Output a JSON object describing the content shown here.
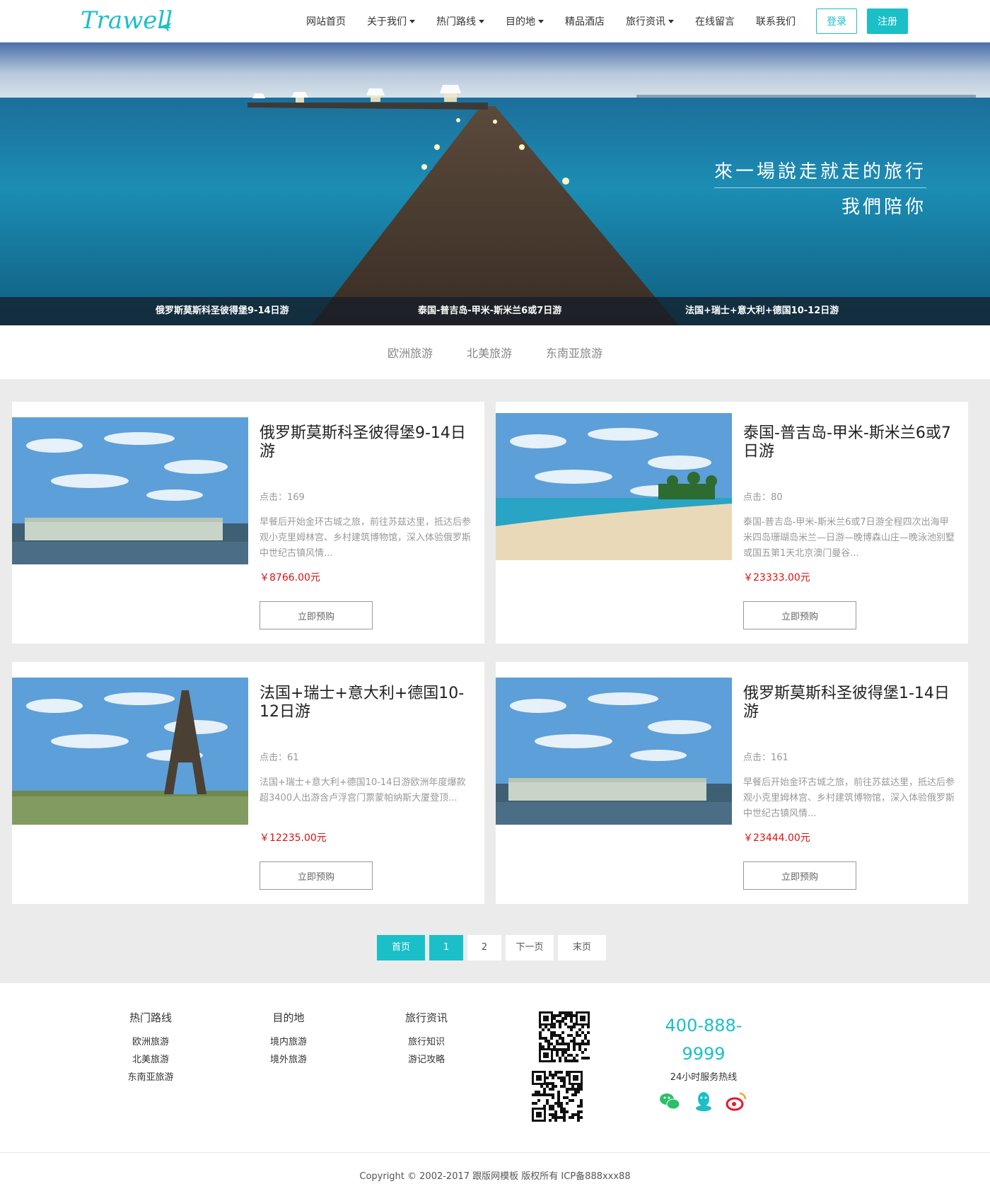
{
  "brand": {
    "logo_text": "Trawell",
    "accent": "#1bbfc7",
    "price_color": "#dd1111"
  },
  "nav": {
    "items": [
      {
        "label": "网站首页",
        "dropdown": false
      },
      {
        "label": "关于我们",
        "dropdown": true
      },
      {
        "label": "热门路线",
        "dropdown": true
      },
      {
        "label": "目的地",
        "dropdown": true
      },
      {
        "label": "精品酒店",
        "dropdown": false
      },
      {
        "label": "旅行资讯",
        "dropdown": true
      },
      {
        "label": "在线留言",
        "dropdown": false
      },
      {
        "label": "联系我们",
        "dropdown": false
      }
    ],
    "login": "登录",
    "register": "注册"
  },
  "banner": {
    "caption_line1": "來一場說走就走的旅行",
    "caption_line2": "我們陪你",
    "bar": [
      "俄罗斯莫斯科圣彼得堡9-14日游",
      "泰国-普吉岛-甲米-斯米兰6或7日游",
      "法国+瑞士+意大利+德国10-12日游"
    ]
  },
  "categories": [
    "欧洲旅游",
    "北美旅游",
    "东南亚旅游"
  ],
  "products": [
    {
      "title": "俄罗斯莫斯科圣彼得堡9-14日游",
      "clicks": "点击：169",
      "desc": "早餐后开始金环古城之旅，前往苏兹达里，抵达后参观小克里姆林宫、乡村建筑博物馆，深入体验俄罗斯中世纪古镇风情...",
      "price": "￥8766.00元",
      "book": "立即预购",
      "image": "palace"
    },
    {
      "title": "泰国-普吉岛-甲米-斯米兰6或7日游",
      "clicks": "点击：80",
      "desc": "泰国-普吉岛-甲米-斯米兰6或7日游全程四次出海甲米四岛珊瑚岛米兰—日游—晚博森山庄—晚泳池别墅或国五第1天北京澳门曼谷...",
      "price": "￥23333.00元",
      "book": "立即预购",
      "image": "beach"
    },
    {
      "title": "法国+瑞士+意大利+德国10-12日游",
      "clicks": "点击：61",
      "desc": "法国+瑞士+意大利+德国10-14日游欧洲年度爆款超3400人出游含卢浮宫门票蒙帕纳斯大厦登顶...",
      "price": "￥12235.00元",
      "book": "立即预购",
      "image": "eiffel"
    },
    {
      "title": "俄罗斯莫斯科圣彼得堡1-14日游",
      "clicks": "点击：161",
      "desc": "早餐后开始金环古城之旅，前往苏兹达里，抵达后参观小克里姆林宫、乡村建筑博物馆，深入体验俄罗斯中世纪古镇风情...",
      "price": "￥23444.00元",
      "book": "立即预购",
      "image": "palace"
    }
  ],
  "pagination": [
    "首页",
    "1",
    "2",
    "下一页",
    "末页"
  ],
  "footer": {
    "columns": [
      {
        "title": "热门路线",
        "links": [
          "欧洲旅游",
          "北美旅游",
          "东南亚旅游"
        ]
      },
      {
        "title": "目的地",
        "links": [
          "境内旅游",
          "境外旅游"
        ]
      },
      {
        "title": "旅行资讯",
        "links": [
          "旅行知识",
          "游记攻略"
        ]
      }
    ],
    "phone_line1": "400-888-",
    "phone_line2": "9999",
    "hotline_label": "24小时服务热线",
    "social_icons": [
      "wechat-icon",
      "qq-icon",
      "weibo-icon"
    ],
    "copyright": "Copyright © 2002-2017 跟版网模板 版权所有 ICP备888xxx88"
  }
}
